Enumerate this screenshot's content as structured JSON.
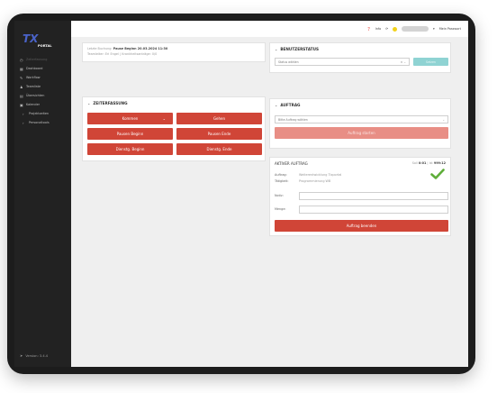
{
  "sidebar": {
    "logo_text": "TX",
    "logo_sub": "PORTAL",
    "items": [
      {
        "label": "Zeiterfassung",
        "icon": "clock-icon",
        "dim": true
      },
      {
        "label": "Dashboard",
        "icon": "dashboard-icon"
      },
      {
        "label": "Workflow",
        "icon": "pencil-icon"
      },
      {
        "label": "Teamliste",
        "icon": "person-icon"
      },
      {
        "label": "Übersichten",
        "icon": "table-icon"
      },
      {
        "label": "Kalender",
        "icon": "calendar-icon"
      },
      {
        "label": "Projektzeiten",
        "icon": "chevron-right-icon",
        "sub": true
      },
      {
        "label": "Personaltools",
        "icon": "chevron-right-icon",
        "sub": true
      }
    ],
    "version": "Version: 3.4.4"
  },
  "topbar": {
    "info_label": "Info",
    "password_label": "Mein Passwort"
  },
  "info": {
    "last_booking_label": "Letzte Buchung:",
    "last_booking_value": "Pause Beginn 20.03.2024 11:30",
    "team_label": "Teamleiter: Eri Engel",
    "team_value": "Krankheitsanträge: 0/0"
  },
  "zeiterfassung": {
    "title": "ZEITERFASSUNG",
    "buttons": {
      "kommen": "Kommen",
      "gehen": "Gehen",
      "pause_beginn": "Pausen Beginn",
      "pause_ende": "Pausen Ende",
      "dienstg_beginn": "Dienstg. Beginn",
      "dienstg_ende": "Dienstg. Ende"
    }
  },
  "benutzerstatus": {
    "title": "BENUTZERSTATUS",
    "select_placeholder": "Status wählen",
    "apply_label": "Setzen"
  },
  "auftrag": {
    "title": "AUFTRAG",
    "select_placeholder": "Bitte Auftrag wählen",
    "start_label": "Auftrag starten"
  },
  "aktiver_auftrag": {
    "title": "AKTIVER AUFTRAG",
    "soll_label": "Soll",
    "soll_value": "0:01",
    "ist_label": "Ist",
    "ist_value": "999:12",
    "auftrag_label": "Auftrag:",
    "auftrag_value": "Weiterentwicklung Tixportal",
    "taetigkeit_label": "Tätigkeit:",
    "taetigkeit_value": "Programmierung WB",
    "notiz_label": "Notiz:",
    "menge_label": "Menge:",
    "end_label": "Auftrag beenden",
    "accent": "#d04537",
    "check_color": "#5fae3a"
  }
}
